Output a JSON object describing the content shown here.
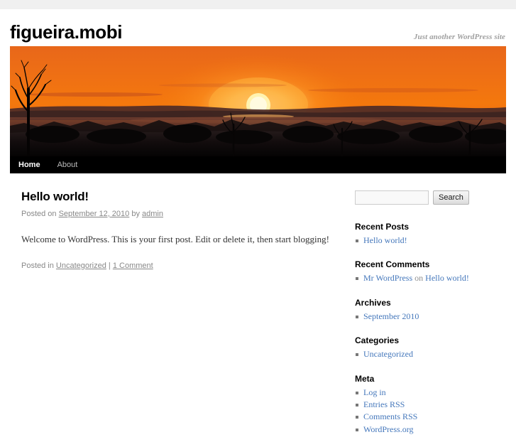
{
  "site": {
    "title": "figueira.mobi",
    "description": "Just another WordPress site",
    "header_image_alt": "sunset-over-treeline-header-image"
  },
  "nav": {
    "items": [
      {
        "label": "Home",
        "current": true
      },
      {
        "label": "About",
        "current": false
      }
    ]
  },
  "post": {
    "title": "Hello world!",
    "meta_prefix": "Posted on ",
    "date": "September 12, 2010",
    "meta_by": " by ",
    "author": "admin",
    "content": "Welcome to WordPress. This is your first post. Edit or delete it, then start blogging!",
    "utility_prefix": "Posted in ",
    "category": "Uncategorized",
    "utility_sep": " | ",
    "comments": "1 Comment"
  },
  "sidebar": {
    "search": {
      "value": "",
      "placeholder": "",
      "submit_label": "Search"
    },
    "widgets": [
      {
        "title": "Recent Posts",
        "items": [
          {
            "link": "Hello world!"
          }
        ]
      },
      {
        "title": "Recent Comments",
        "items": [
          {
            "link": "Mr WordPress",
            "middle": " on ",
            "link2": "Hello world!"
          }
        ]
      },
      {
        "title": "Archives",
        "items": [
          {
            "link": "September 2010"
          }
        ]
      },
      {
        "title": "Categories",
        "items": [
          {
            "link": "Uncategorized"
          }
        ]
      },
      {
        "title": "Meta",
        "items": [
          {
            "link": "Log in"
          },
          {
            "link": "Entries RSS"
          },
          {
            "link": "Comments RSS"
          },
          {
            "link": "WordPress.org"
          }
        ]
      }
    ]
  },
  "colors": {
    "link": "#4477bb",
    "nav_background": "#000000",
    "muted_text": "#888888",
    "chrome_strip": "#f0f0f0"
  }
}
